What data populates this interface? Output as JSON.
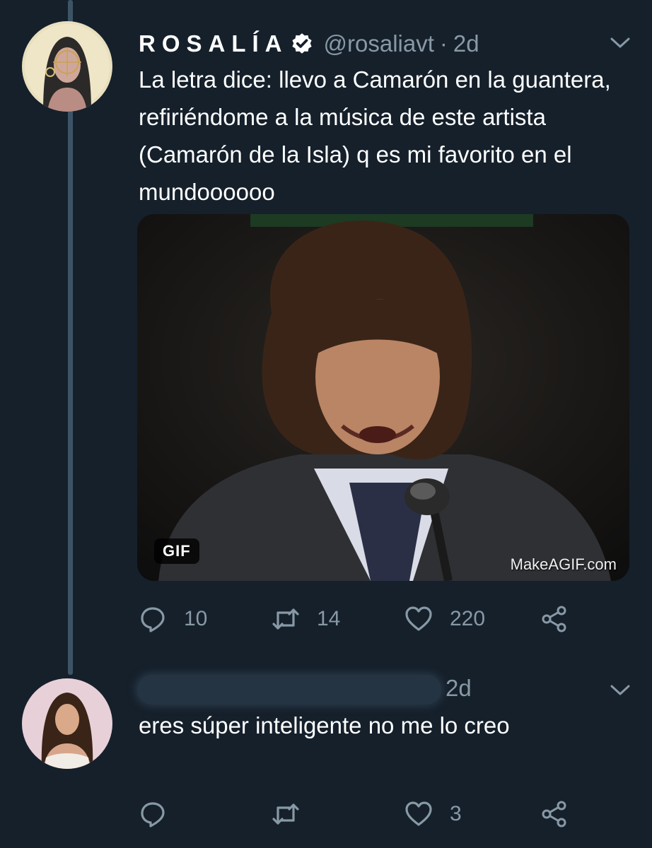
{
  "tweet": {
    "display_name": "ROSALÍA",
    "handle": "@rosaliavt",
    "separator": "·",
    "time": "2d",
    "text": "La letra dice: llevo a Camarón en la guantera, refiriéndome a la música de este artista (Camarón de la Isla) q es mi favorito en el mundoooooo",
    "media": {
      "badge": "GIF",
      "watermark": "MakeAGIF.com"
    },
    "actions": {
      "replies": "10",
      "retweets": "14",
      "likes": "220"
    },
    "icons": [
      "verified-icon",
      "chevron-down-icon",
      "reply-icon",
      "retweet-icon",
      "like-icon",
      "share-icon"
    ]
  },
  "reply": {
    "time": "2d",
    "text": "eres súper inteligente no me lo creo",
    "actions": {
      "replies": "",
      "retweets": "",
      "likes": "3"
    }
  },
  "colors": {
    "background": "#15202b",
    "text_primary": "#ffffff",
    "text_secondary": "#8899a6",
    "thread_line": "#3d5466",
    "verified": "#ffffff"
  }
}
